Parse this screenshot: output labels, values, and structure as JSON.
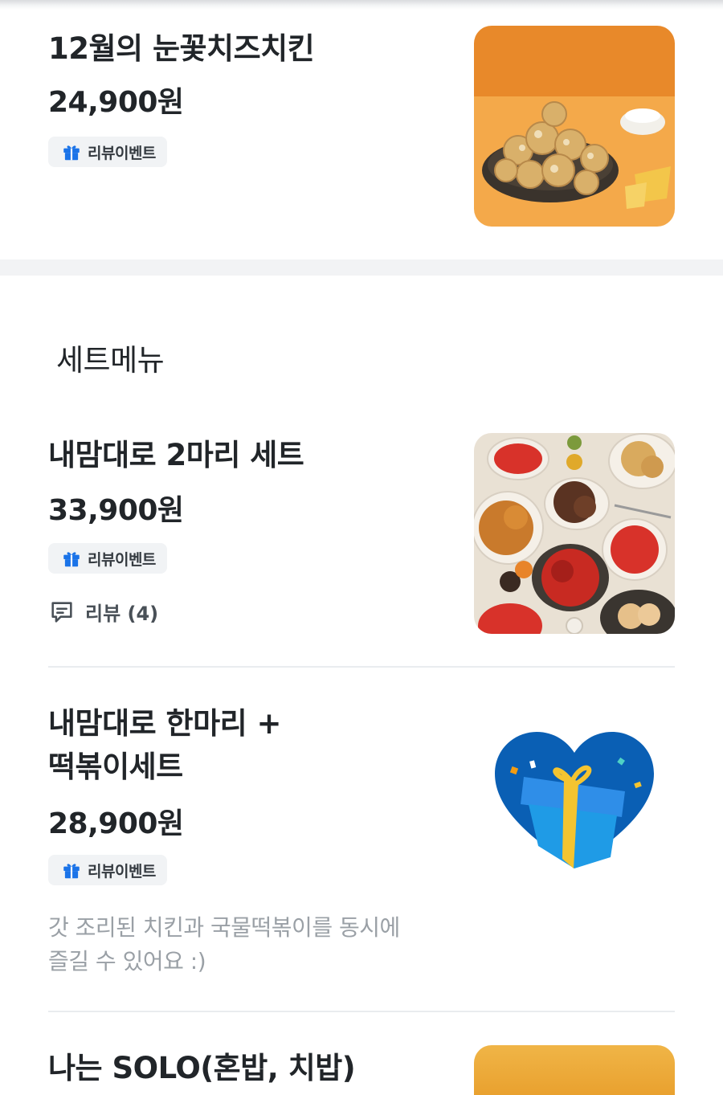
{
  "menu_items": [
    {
      "name": "12월의 눈꽃치즈치킨",
      "price": "24,900원",
      "badge": "리뷰이벤트",
      "image_icon": "cheese-chicken-photo"
    },
    {
      "name": "내맘대로 2마리 세트",
      "price": "33,900원",
      "badge": "리뷰이벤트",
      "review": "리뷰 (4)",
      "image_icon": "chicken-set-photo"
    },
    {
      "name_line1": "내맘대로 한마리 +",
      "name_line2": "떡볶이세트",
      "price": "28,900원",
      "badge": "리뷰이벤트",
      "desc_line1": "갓 조리된 치킨과 국물떡볶이를 동시에",
      "desc_line2": "즐길 수 있어요 :)",
      "image_icon": "heart-gift-icon"
    },
    {
      "name": "나는 SOLO(혼밥, 치밥)",
      "image_icon": "solo-meal-photo"
    }
  ],
  "section": {
    "title": "세트메뉴"
  },
  "colors": {
    "text": "#212529",
    "badge_bg": "#f1f3f5",
    "gift_icon": "#1a73e8",
    "desc": "#9aa0a6",
    "section_gap": "#f2f3f5"
  }
}
